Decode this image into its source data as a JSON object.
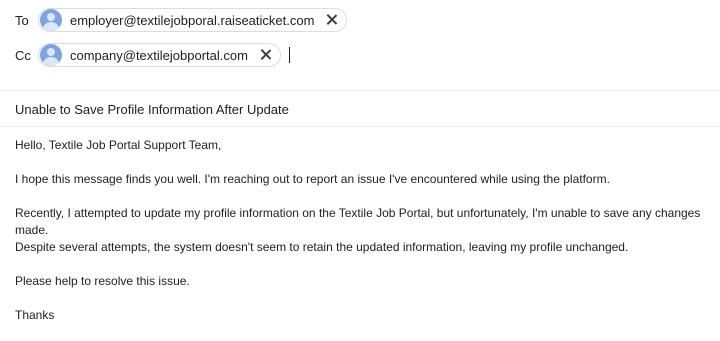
{
  "recipients": {
    "to_label": "To",
    "to": [
      {
        "email": "employer@textilejobporal.raiseaticket.com"
      }
    ],
    "cc_label": "Cc",
    "cc": [
      {
        "email": "company@textilejobportal.com"
      }
    ]
  },
  "subject": "Unable to Save Profile Information After Update",
  "message": {
    "greeting": "Hello, Textile Job Portal Support Team,",
    "p1": "I hope this message finds you well. I'm reaching out to report an issue I've encountered while using the platform.",
    "p2_line1": "Recently, I attempted to update my profile information on the Textile Job Portal, but unfortunately, I'm unable to save any changes made.",
    "p2_line2": "Despite several attempts, the system doesn't seem to retain the updated information, leaving my profile unchanged.",
    "p3": "Please help to resolve this issue.",
    "signoff": "Thanks"
  },
  "icons": {
    "avatar": "person-avatar-icon",
    "remove": "close-icon"
  },
  "colors": {
    "avatar_bg": "#7ea3e0",
    "chip_border": "#dadce0",
    "divider": "#eceff1"
  }
}
